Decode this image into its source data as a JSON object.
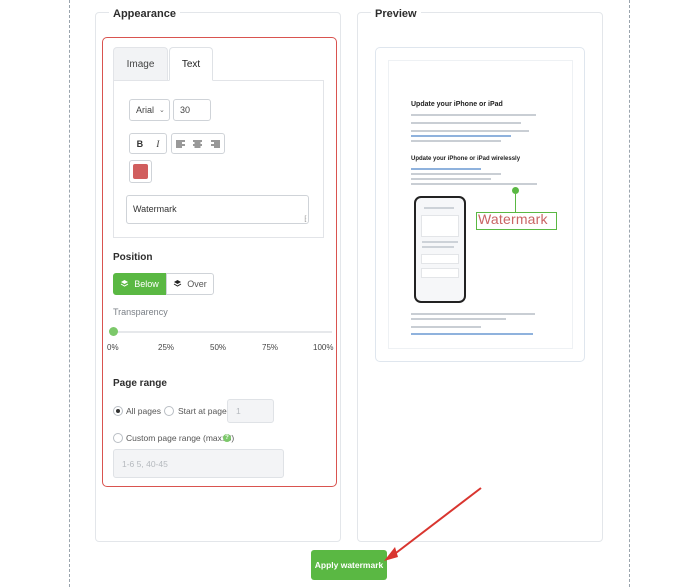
{
  "appearance": {
    "title": "Appearance",
    "tabs": [
      {
        "label": "Image",
        "active": false
      },
      {
        "label": "Text",
        "active": true
      }
    ],
    "font": {
      "family": "Arial",
      "size": "30"
    },
    "format_buttons": {
      "bold": "B",
      "italic": "I"
    },
    "text_color": "#d15e5e",
    "watermark_text": "Watermark",
    "position": {
      "label": "Position",
      "options": [
        {
          "label": "Below",
          "selected": true
        },
        {
          "label": "Over",
          "selected": false
        }
      ]
    },
    "transparency": {
      "label": "Transparency",
      "value": 0,
      "ticks": [
        "0%",
        "25%",
        "50%",
        "75%",
        "100%"
      ]
    },
    "page_range": {
      "label": "Page range",
      "all_pages": "All pages",
      "start_at_page": "Start at page",
      "start_page_value": "1",
      "custom_label": "Custom page range (max: 3)",
      "custom_placeholder": "1-6 5, 40-45",
      "selected": "all_pages"
    }
  },
  "preview": {
    "title": "Preview",
    "doc": {
      "heading1": "Update your iPhone or iPad",
      "heading2": "Update your iPhone or iPad wirelessly"
    },
    "watermark_text": "Watermark"
  },
  "apply_button": "Apply watermark",
  "colors": {
    "accent": "#5ab843",
    "highlight": "#d9534f"
  }
}
